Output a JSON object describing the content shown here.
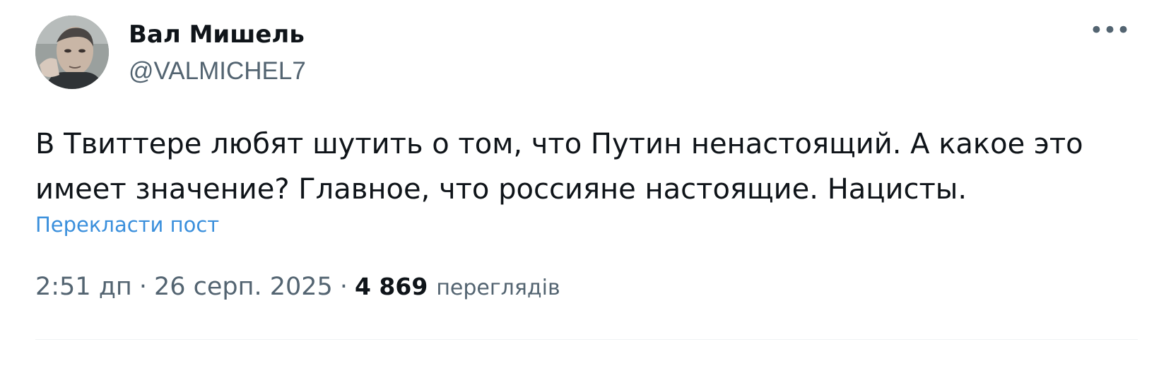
{
  "author": {
    "display_name": "Вал Мишель",
    "handle": "@VALMICHEL7"
  },
  "tweet": {
    "text_line_1": "В Твиттере любят шутить о том, что Путин ненастоящий. А какое это",
    "text_line_2": "имеет значение? Главное, что россияне настоящие. Нацисты.",
    "translate_label": "Перекласти пост",
    "time": "2:51 дп",
    "separator": "·",
    "date": "26 серп. 2025",
    "views_count": "4 869",
    "views_label": "переглядів"
  },
  "more_icon": "more-horizontal-icon",
  "colors": {
    "text_primary": "#0f1419",
    "text_secondary": "#536471",
    "link": "#3a8fdc",
    "divider": "#eff3f4"
  }
}
